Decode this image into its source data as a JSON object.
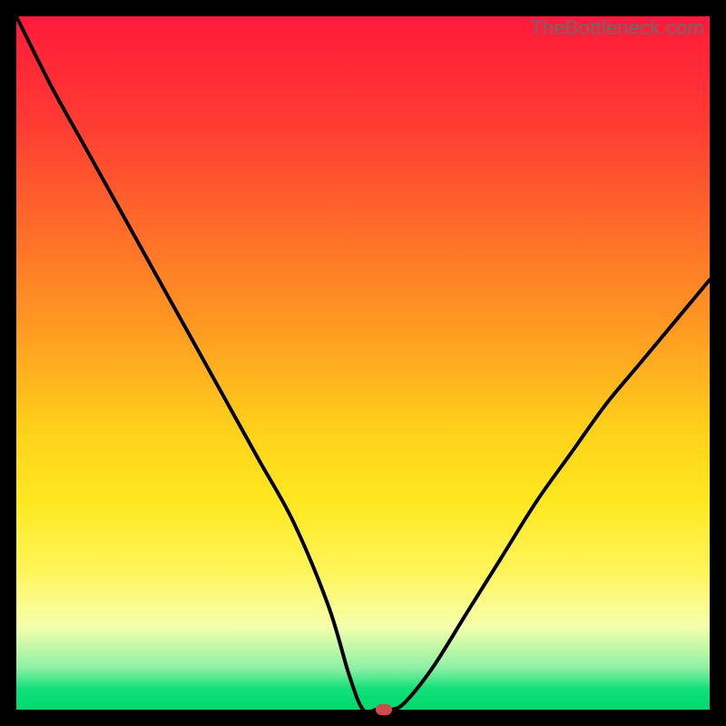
{
  "watermark": "TheBottleneck.com",
  "colors": {
    "frame": "#000000",
    "curve": "#000000",
    "marker": "#cc4b4b",
    "gradient_stops": [
      "#ff1a3a",
      "#ff3a33",
      "#ff6a2a",
      "#ff9a22",
      "#ffd21a",
      "#ffe820",
      "#fff55a",
      "#f6ffab",
      "#8df0a4",
      "#12e07a",
      "#00d86e"
    ]
  },
  "chart_data": {
    "type": "line",
    "title": "",
    "xlabel": "",
    "ylabel": "",
    "xlim": [
      0,
      100
    ],
    "ylim": [
      0,
      100
    ],
    "grid": false,
    "legend": false,
    "annotations": [
      "TheBottleneck.com"
    ],
    "series": [
      {
        "name": "bottleneck-curve",
        "x": [
          0,
          5,
          10,
          15,
          20,
          25,
          30,
          35,
          40,
          45,
          48,
          50,
          52,
          54,
          56,
          60,
          65,
          70,
          75,
          80,
          85,
          90,
          95,
          100
        ],
        "y": [
          100,
          90,
          81,
          72,
          63,
          54,
          45,
          36,
          27,
          15,
          5,
          0,
          0,
          0,
          1,
          6,
          14,
          22,
          30,
          37,
          44,
          50,
          56,
          62
        ]
      }
    ],
    "marker_point": {
      "x": 53,
      "y": 0
    }
  }
}
